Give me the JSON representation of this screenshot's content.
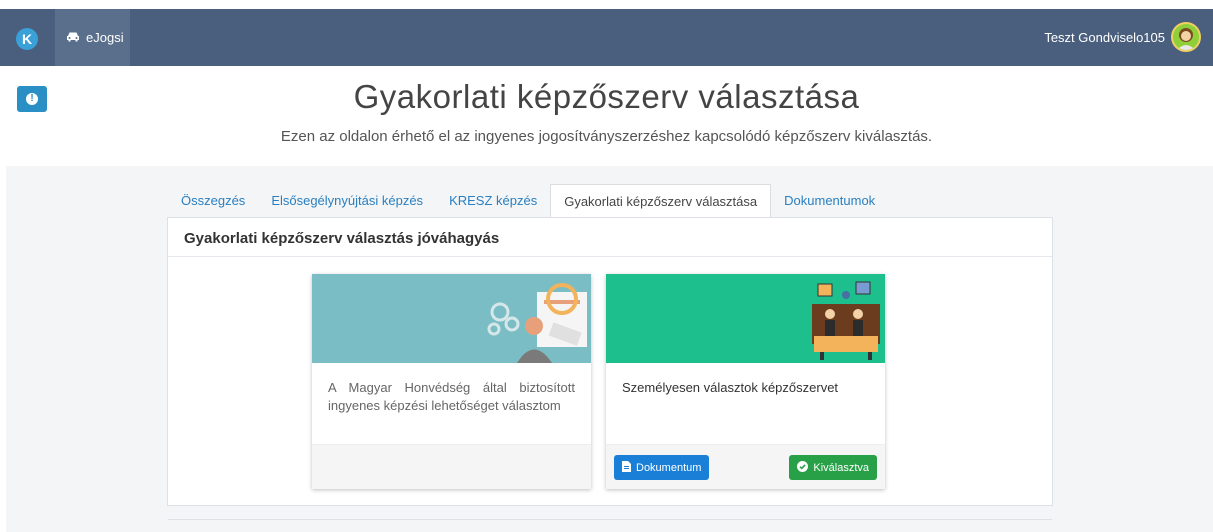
{
  "header": {
    "logo_letter": "K",
    "app_name": "eJogsi",
    "user_name": "Teszt Gondviselo105"
  },
  "page": {
    "title": "Gyakorlati képzőszerv választása",
    "subtitle": "Ezen az oldalon érhető el az ingyenes jogosítványszerzéshez kapcsolódó képzőszerv kiválasztás."
  },
  "tabs": [
    {
      "label": "Összegzés",
      "active": false
    },
    {
      "label": "Elsősegélynyújtási képzés",
      "active": false
    },
    {
      "label": "KRESZ képzés",
      "active": false
    },
    {
      "label": "Gyakorlati képzőszerv választása",
      "active": true
    },
    {
      "label": "Dokumentumok",
      "active": false
    }
  ],
  "panel": {
    "title": "Gyakorlati képzőszerv választás jóváhagyás"
  },
  "cards": [
    {
      "text": "A Magyar Honvédség által biztosított ingyenes képzési lehetőséget választom",
      "image_color": "#7bbdc4"
    },
    {
      "text": "Személyesen választok képzőszervet",
      "image_color": "#1dbf8c",
      "document_button": "Dokumentum",
      "selected_button": "Kiválasztva"
    }
  ],
  "colors": {
    "topbar": "#4a5f7e",
    "accent_blue": "#1a7fd6",
    "success_green": "#27a048"
  }
}
